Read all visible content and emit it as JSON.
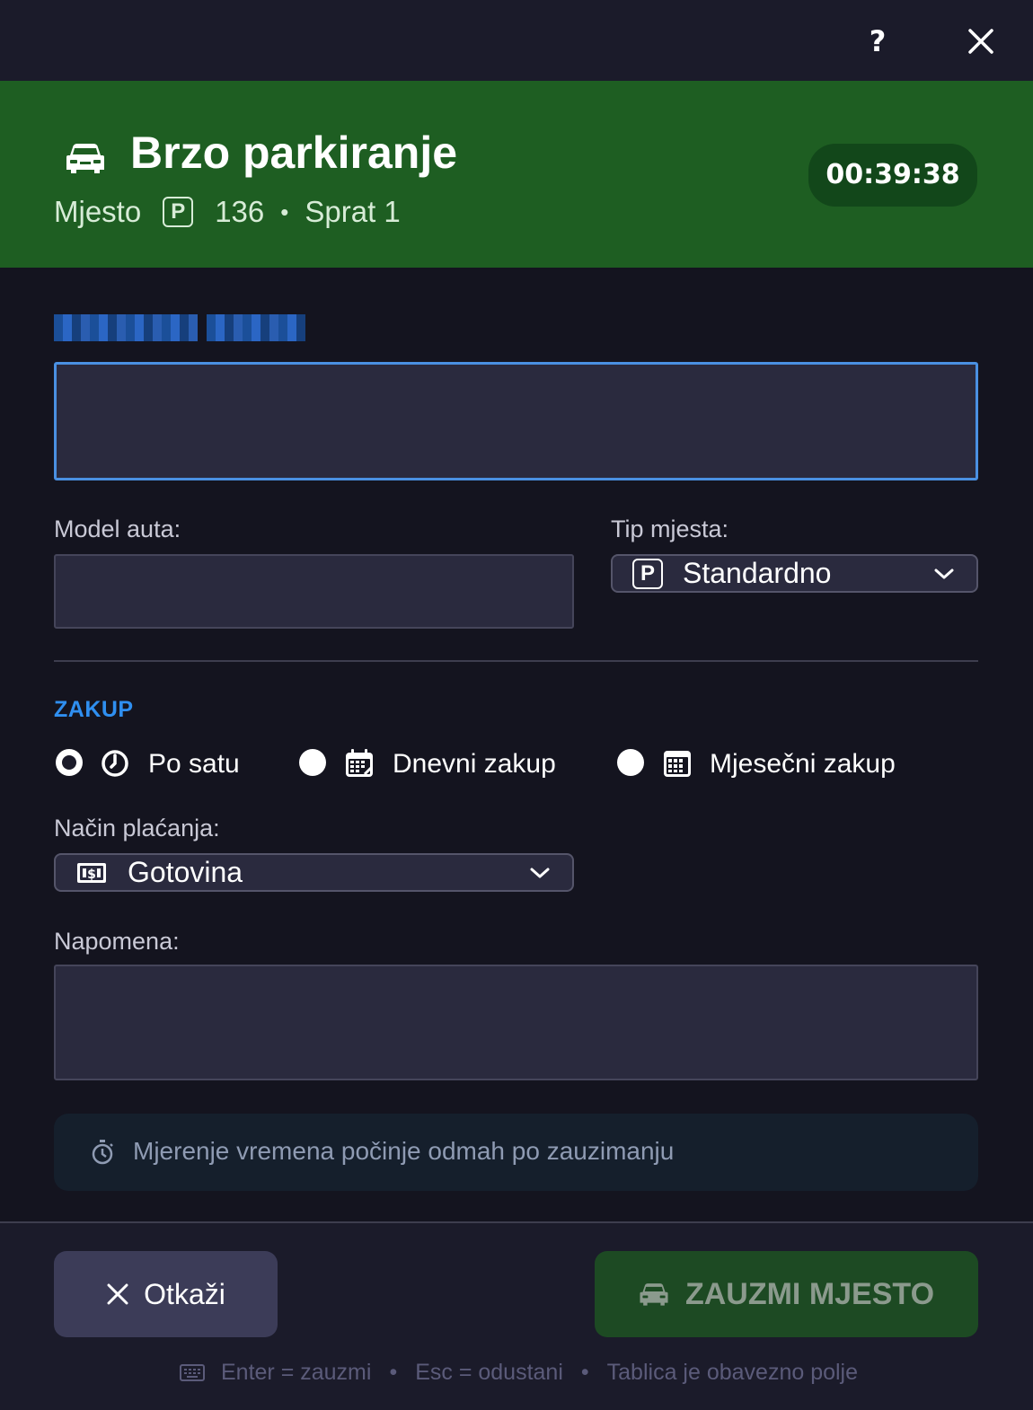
{
  "titlebar": {
    "help_label": "?",
    "close_icon": "close-icon"
  },
  "header": {
    "title": "Brzo parkiranje",
    "subtitle_place": "Mjesto",
    "parking_badge": "P",
    "spot_number": "136",
    "separator": "•",
    "floor": "Sprat 1",
    "timer": "00:39:38",
    "accent_color": "#1e5e22"
  },
  "plate": {
    "label_redacted": true,
    "value": ""
  },
  "car_model": {
    "label": "Model auta:",
    "value": ""
  },
  "spot_type": {
    "label": "Tip mjesta:",
    "icon_text": "P",
    "selected": "Standardno"
  },
  "lease": {
    "section_title": "ZAKUP",
    "options": [
      {
        "label": "Po satu",
        "icon": "clock-icon",
        "checked": true
      },
      {
        "label": "Dnevni zakup",
        "icon": "calendar-day-icon",
        "checked": false
      },
      {
        "label": "Mjesečni zakup",
        "icon": "calendar-month-icon",
        "checked": false
      }
    ]
  },
  "payment": {
    "label": "Način plaćanja:",
    "selected": "Gotovina",
    "icon_text": "$"
  },
  "note": {
    "label": "Napomena:",
    "value": ""
  },
  "info": {
    "text": "Mjerenje vremena počinje odmah po zauzimanju"
  },
  "footer": {
    "cancel_label": "Otkaži",
    "confirm_label": "ZAUZMI MJESTO",
    "hint_enter": "Enter = zauzmi",
    "hint_esc": "Esc = odustani",
    "hint_required": "Tablica je obavezno polje",
    "hint_separator": "•"
  }
}
